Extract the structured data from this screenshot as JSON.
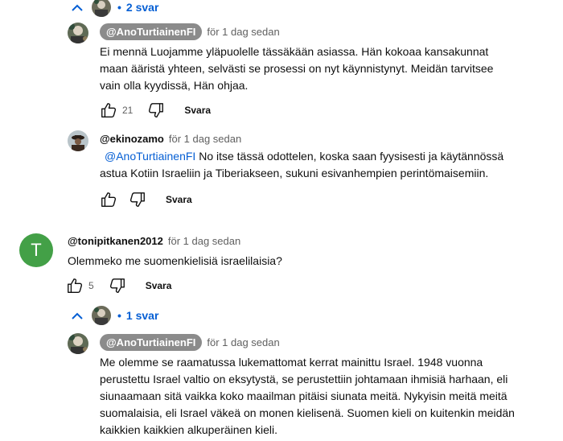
{
  "thread1_toggle": {
    "label": "2 svar"
  },
  "reply1": {
    "handle": "@AnoTurtiainenFI",
    "time": "för 1 dag sedan",
    "lines": [
      "Ei mennä Luojamme yläpuolelle tässäkään asiassa. Hän kokoaa kansakunnat",
      "maan ääristä yhteen, selvästi se prosessi on nyt käynnistynyt. Meidän tarvitsee",
      "vain olla kyydissä, Hän ohjaa."
    ],
    "likes": "21",
    "reply_label": "Svara"
  },
  "reply2": {
    "handle": "@ekinozamo",
    "time": "för 1 dag sedan",
    "mention": "@AnoTurtiainenFI",
    "line1_rest": " No itse tässä odottelen, koska saan fyysisesti ja käytännössä",
    "line2": "astua Kotiin Israeliin ja Tiberiakseen, sukuni esivanhempien perintömaisemiin.",
    "reply_label": "Svara"
  },
  "comment": {
    "avatar_letter": "T",
    "handle": "@tonipitkanen2012",
    "time": "för 1 dag sedan",
    "text": "Olemmeko me suomenkielisiä israelilaisia?",
    "likes": "5",
    "reply_label": "Svara"
  },
  "thread2_toggle": {
    "label": "1 svar"
  },
  "reply3": {
    "handle": "@AnoTurtiainenFI",
    "time": "för 1 dag sedan",
    "lines": [
      "Me olemme se raamatussa lukemattomat kerrat mainittu Israel. 1948 vuonna",
      "perustettu Israel valtio on eksytystä, se perustettiin johtamaan ihmisiä harhaan, eli",
      "siunaamaan sitä vaikka koko maailman pitäisi siunata meitä. Nykyisin meitä meitä",
      "suomalaisia, eli Israel väkeä on monen kielisenä. Suomen kieli on kuitenkin meidän",
      "kaikkien kaikkien alkuperäinen kieli."
    ]
  },
  "colors": {
    "link": "#065fd4",
    "chip": "#8b8b8b",
    "letter_avatar": "#43a047"
  },
  "icons": [
    "chevron-up-icon",
    "thumb-up-icon",
    "thumb-down-icon"
  ]
}
